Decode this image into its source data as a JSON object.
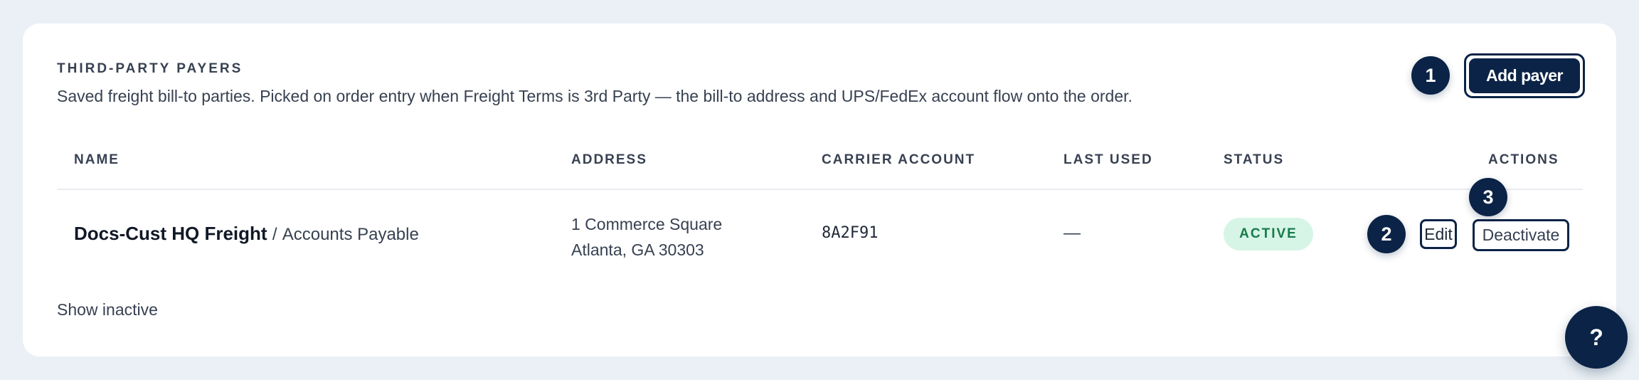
{
  "section": {
    "title": "THIRD-PARTY PAYERS",
    "description": "Saved freight bill-to parties. Picked on order entry when Freight Terms is 3rd Party — the bill-to address and UPS/FedEx account flow onto the order."
  },
  "header_actions": {
    "add_payer_label": "Add payer"
  },
  "annotations": {
    "badge_1": "1",
    "badge_2": "2",
    "badge_3": "3"
  },
  "table": {
    "columns": {
      "name": "NAME",
      "address": "ADDRESS",
      "carrier_account": "CARRIER ACCOUNT",
      "last_used": "LAST USED",
      "status": "STATUS",
      "actions": "ACTIONS"
    },
    "rows": [
      {
        "name": "Docs-Cust HQ Freight",
        "separator": "/",
        "contact": "Accounts Payable",
        "address_line1": "1 Commerce Square",
        "address_line2": "Atlanta, GA 30303",
        "carrier_account": "8A2F91",
        "last_used": "—",
        "status": "ACTIVE",
        "edit_label": "Edit",
        "deactivate_label": "Deactivate"
      }
    ]
  },
  "footer": {
    "show_inactive_label": "Show inactive"
  },
  "help": {
    "label": "?"
  },
  "colors": {
    "navy": "#0b2346",
    "active_bg": "#d7f5e6",
    "active_text": "#157a4b",
    "page_bg": "#eaf0f5"
  }
}
